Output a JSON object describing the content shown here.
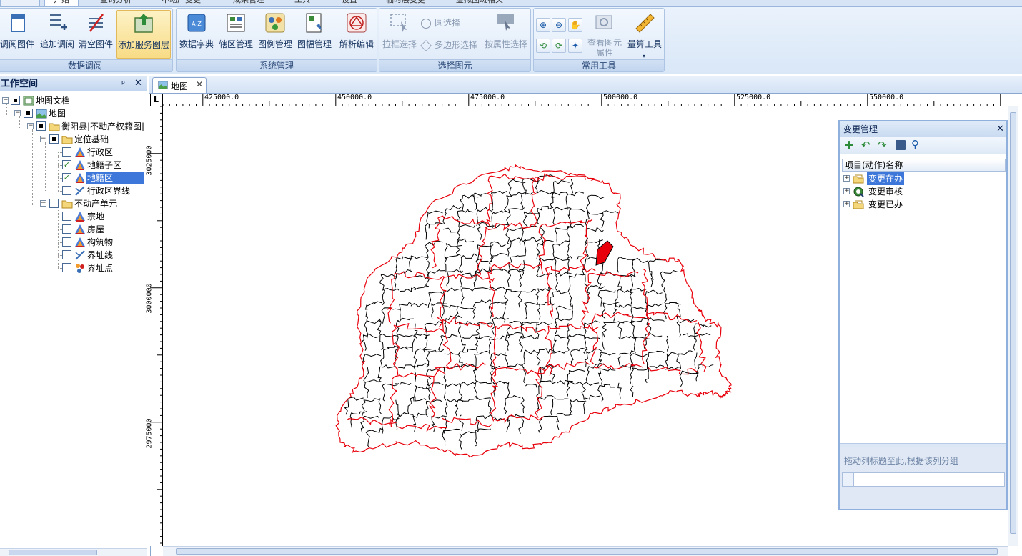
{
  "ribbon_tabs": [
    "开始",
    "查询分析",
    "不动产变更",
    "成果管理",
    "工具",
    "设置",
    "临时层变更",
    "虚拟图斑相关"
  ],
  "groups": {
    "data_load": {
      "title": "数据调阅",
      "buttons": [
        "调阅图件",
        "追加调阅",
        "清空图件",
        "添加服务图层"
      ]
    },
    "system": {
      "title": "系统管理",
      "buttons": [
        "数据字典",
        "辖区管理",
        "图例管理",
        "图幅管理",
        "解析编辑"
      ]
    },
    "select": {
      "title": "选择图元",
      "rect": "拉框选择",
      "circle": "圆选择",
      "polygon": "多边形选择",
      "attr": "按属性选择"
    },
    "common": {
      "title": "常用工具",
      "view_attr_1": "查看图元",
      "view_attr_2": "属性",
      "measure": "量算工具"
    }
  },
  "workspace": {
    "title": "工作空间",
    "pin": "ᵖ",
    "close": "✕",
    "tree": {
      "doc": "地图文档",
      "map": "地图",
      "layer_group": "衡阳县|不动产权籍图|",
      "base": "定位基础",
      "base_items": [
        "行政区",
        "地籍子区",
        "地籍区",
        "行政区界线"
      ],
      "unit": "不动产单元",
      "unit_items": [
        "宗地",
        "房屋",
        "构筑物",
        "界址线",
        "界址点"
      ]
    }
  },
  "doc_tab": {
    "label": "地图",
    "close": "✕"
  },
  "ruler": {
    "corner": "L",
    "h_ticks": [
      "425000.0",
      "450000.0",
      "475000.0",
      "500000.0",
      "525000.0",
      "550000.0"
    ],
    "v_ticks": [
      "3025000",
      "3000000",
      "2975000"
    ]
  },
  "change_panel": {
    "title": "变更管理",
    "close": "✕",
    "column": "项目(动作)名称",
    "items": [
      "变更在办",
      "变更审核",
      "变更已办"
    ],
    "group_hint": "拖动列标题至此,根据该列分组"
  },
  "colors": {
    "map_red": "#e8000b",
    "map_black": "#000000",
    "selection": "#3d77d9"
  }
}
